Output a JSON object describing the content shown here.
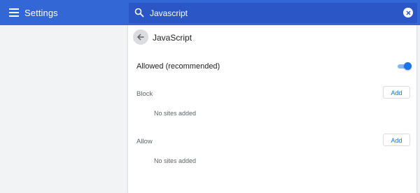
{
  "header": {
    "title": "Settings",
    "menu_icon": "hamburger-menu-icon"
  },
  "search": {
    "value": "Javascript",
    "icon": "search-icon",
    "clear_icon": "close-circle-icon"
  },
  "page": {
    "back_icon": "arrow-back-icon",
    "title": "JavaScript",
    "main_setting": {
      "label": "Allowed (recommended)",
      "enabled": true
    },
    "block": {
      "label": "Block",
      "add_label": "Add",
      "empty_text": "No sites added"
    },
    "allow": {
      "label": "Allow",
      "add_label": "Add",
      "empty_text": "No sites added"
    }
  },
  "colors": {
    "header_bg": "#3367d6",
    "search_bg": "#2a56c6",
    "accent": "#1a73e8",
    "page_bg": "#f1f3f4"
  }
}
